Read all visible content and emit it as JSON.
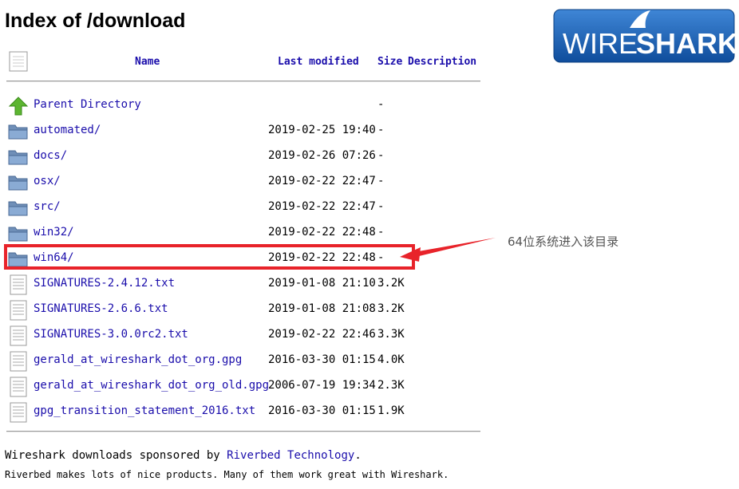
{
  "page": {
    "title": "Index of /download"
  },
  "logo": {
    "text_left": "WIRE",
    "text_right": "SHARK"
  },
  "table": {
    "headers": {
      "name": "Name",
      "last_modified": "Last modified",
      "size": "Size",
      "description": "Description"
    },
    "rows": [
      {
        "icon": "parent-directory-icon",
        "name": "Parent Directory",
        "date": "",
        "size": "-"
      },
      {
        "icon": "folder-icon",
        "name": "automated/",
        "date": "2019-02-25 19:40",
        "size": "-"
      },
      {
        "icon": "folder-icon",
        "name": "docs/",
        "date": "2019-02-26 07:26",
        "size": "-"
      },
      {
        "icon": "folder-icon",
        "name": "osx/",
        "date": "2019-02-22 22:47",
        "size": "-"
      },
      {
        "icon": "folder-icon",
        "name": "src/",
        "date": "2019-02-22 22:47",
        "size": "-"
      },
      {
        "icon": "folder-icon",
        "name": "win32/",
        "date": "2019-02-22 22:48",
        "size": "-"
      },
      {
        "icon": "folder-icon",
        "name": "win64/",
        "date": "2019-02-22 22:48",
        "size": "-"
      },
      {
        "icon": "text-file-icon",
        "name": "SIGNATURES-2.4.12.txt",
        "date": "2019-01-08 21:10",
        "size": "3.2K"
      },
      {
        "icon": "text-file-icon",
        "name": "SIGNATURES-2.6.6.txt",
        "date": "2019-01-08 21:08",
        "size": "3.2K"
      },
      {
        "icon": "text-file-icon",
        "name": "SIGNATURES-3.0.0rc2.txt",
        "date": "2019-02-22 22:46",
        "size": "3.3K"
      },
      {
        "icon": "text-file-icon",
        "name": "gerald_at_wireshark_dot_org.gpg",
        "date": "2016-03-30 01:15",
        "size": "4.0K"
      },
      {
        "icon": "text-file-icon",
        "name": "gerald_at_wireshark_dot_org_old.gpg",
        "date": "2006-07-19 19:34",
        "size": "2.3K"
      },
      {
        "icon": "text-file-icon",
        "name": "gpg_transition_statement_2016.txt",
        "date": "2016-03-30 01:15",
        "size": "1.9K"
      }
    ]
  },
  "annotation": {
    "text": "64位系统进入该目录",
    "color": "#e8232a"
  },
  "footer": {
    "line1_prefix": "Wireshark downloads sponsored by ",
    "line1_link": "Riverbed Technology",
    "line1_suffix": ".",
    "line2": "Riverbed makes lots of nice products. Many of them work great with Wireshark."
  },
  "colors": {
    "link": "#1a0dab",
    "logo_blue": "#1a5aa8",
    "highlight": "#e8232a"
  }
}
